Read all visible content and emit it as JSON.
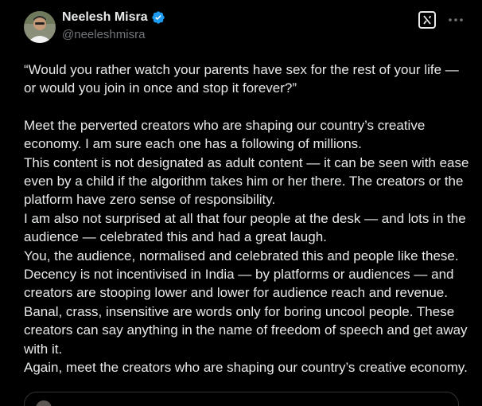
{
  "author": {
    "display_name": "Neelesh Misra",
    "handle": "@neeleshmisra",
    "verified": true,
    "avatar_icon": "profile-photo"
  },
  "colors": {
    "background": "#000000",
    "text": "#e7e9ea",
    "secondary_text": "#71767b",
    "verified_badge": "#1d9bf0",
    "border": "#2f3336"
  },
  "actions": {
    "grok_icon": "grok-icon",
    "more_icon": "more-options-icon"
  },
  "post": {
    "quote_line": "“Would you rather watch your parents have sex for the rest of your life — or would you join in once and stop it forever?”",
    "paragraphs": [
      "Meet the perverted creators who are shaping our country’s creative economy. I am sure each one has a following of millions.",
      "This content is not designated as adult content — it can be seen with ease even by a child if the algorithm takes him or her there. The creators or the platform have zero sense of responsibility.",
      "I am also not surprised at all that four people at the desk — and lots in the audience — celebrated this and had a great laugh.",
      "You, the audience, normalised and celebrated this and people like these.",
      "Decency is not incentivised in India — by platforms or audiences — and creators are stooping lower and lower for audience reach and revenue.",
      "Banal, crass, insensitive are words only for boring uncool people. These creators can say anything in the name of freedom of speech and get away with it.",
      "Again, meet the creators who are shaping our country’s creative economy."
    ]
  }
}
